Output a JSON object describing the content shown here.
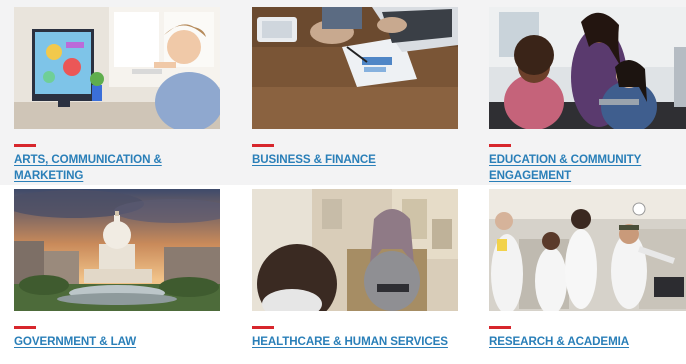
{
  "colors": {
    "accent": "#d7262c",
    "link": "#2a7fb8",
    "band": "#f3f3f4"
  },
  "cards": [
    {
      "label": "ARTS, COMMUNICATION & MARKETING",
      "image": "arts-communication-photo"
    },
    {
      "label": "BUSINESS & FINANCE",
      "image": "business-finance-photo"
    },
    {
      "label": "EDUCATION & COMMUNITY ENGAGEMENT",
      "image": "education-community-photo"
    },
    {
      "label": "GOVERNMENT & LAW",
      "image": "government-law-photo"
    },
    {
      "label": "HEALTHCARE & HUMAN SERVICES",
      "image": "healthcare-human-services-photo"
    },
    {
      "label": "RESEARCH & ACADEMIA",
      "image": "research-academia-photo"
    }
  ]
}
